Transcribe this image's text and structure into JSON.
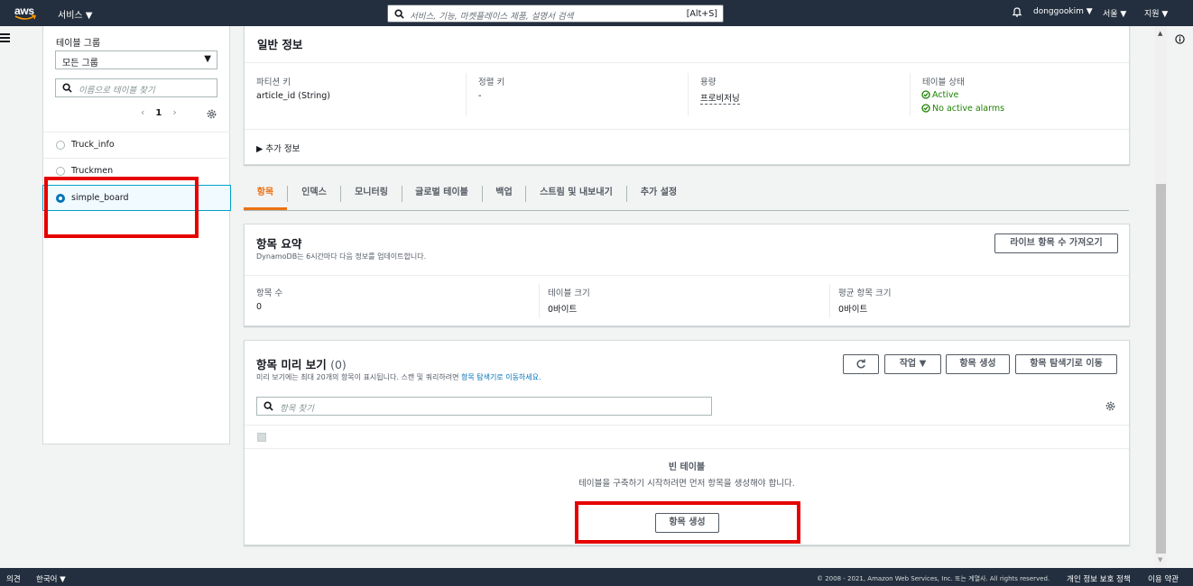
{
  "nav": {
    "logo": "aws",
    "services": "서비스 ▼",
    "search_placeholder": "서비스, 기능, 마켓플레이스 제품, 설명서 검색",
    "search_shortcut": "[Alt+S]",
    "user": "donggookim ▼",
    "region": "서울 ▼",
    "support": "지원 ▼"
  },
  "sidebar": {
    "group_label": "테이블 그룹",
    "group_select": "모든 그룹",
    "search_placeholder": "이름으로 테이블 찾기",
    "page": "1",
    "tables": [
      {
        "name": "Truck_info",
        "selected": false
      },
      {
        "name": "Truckmen",
        "selected": false
      },
      {
        "name": "simple_board",
        "selected": true
      }
    ]
  },
  "general": {
    "title": "일반 정보",
    "fields": [
      {
        "label": "파티션 키",
        "value": "article_id (String)"
      },
      {
        "label": "정렬 키",
        "value": "-"
      },
      {
        "label": "용량",
        "value": "프로비저닝"
      },
      {
        "label": "테이블 상태",
        "value": "Active",
        "value2": "No active alarms"
      }
    ],
    "more_info": "▶ 추가 정보"
  },
  "tabs": [
    "항목",
    "인덱스",
    "모니터링",
    "글로벌 테이블",
    "백업",
    "스트림 및 내보내기",
    "추가 설정"
  ],
  "summary": {
    "title": "항목 요약",
    "subtitle": "DynamoDB는 6시간마다 다음 정보를 업데이트합니다.",
    "button": "라이브 항목 수 가져오기",
    "stats": [
      {
        "label": "항목 수",
        "value": "0"
      },
      {
        "label": "테이블 크기",
        "value": "0바이트"
      },
      {
        "label": "평균 항목 크기",
        "value": "0바이트"
      }
    ]
  },
  "preview": {
    "title": "항목 미리 보기",
    "count": "(0)",
    "desc_prefix": "미리 보기에는 최대 20개의 항목이 표시됩니다. 스캔 및 쿼리하려면 ",
    "desc_link": "항목 탐색기로 이동하세요.",
    "actions_button": "작업 ▼",
    "create_button": "항목 생성",
    "explorer_button": "항목 탐색기로 이동",
    "search_placeholder": "항목 찾기",
    "empty_title": "빈 테이블",
    "empty_desc": "테이블을 구축하기 시작하려면 먼저 항목을 생성해야 합니다.",
    "empty_create_button": "항목 생성"
  },
  "footer": {
    "feedback": "의견",
    "language": "한국어 ▼",
    "copyright": "© 2008 - 2021, Amazon Web Services, Inc. 또는 계열사. All rights reserved.",
    "privacy": "개인 정보 보호 정책",
    "terms": "이용 약관"
  },
  "colors": {
    "nav_bg": "#232f3e",
    "accent": "#ec7211",
    "link": "#0073bb",
    "success": "#1d8102",
    "highlight": "#e60000"
  }
}
